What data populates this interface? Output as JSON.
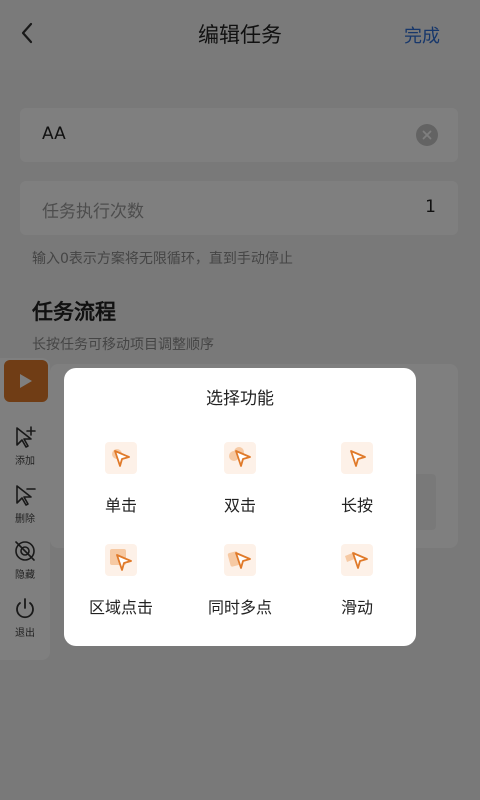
{
  "header": {
    "back_icon": "chevron-left-icon",
    "title": "编辑任务",
    "done_label": "完成",
    "done_color": "#2f6fd6"
  },
  "form": {
    "task_name_value": "AA",
    "clear_icon": "clear-circle-icon",
    "count_label": "任务执行次数",
    "count_value": "1",
    "hint": "输入0表示方案将无限循环，直到手动停止"
  },
  "flow": {
    "title": "任务流程",
    "subtitle": "长按任务可移动项目调整顺序"
  },
  "floating_toolbar": {
    "play_icon": "play-icon",
    "accent_color": "#e07a2a",
    "items": [
      {
        "label": "添加",
        "icon": "add-pointer-icon"
      },
      {
        "label": "删除",
        "icon": "remove-pointer-icon"
      },
      {
        "label": "隐藏",
        "icon": "hide-icon"
      },
      {
        "label": "退出",
        "icon": "power-icon"
      }
    ]
  },
  "dialog": {
    "title": "选择功能",
    "functions": [
      {
        "label": "单击",
        "icon": "single-tap-icon"
      },
      {
        "label": "双击",
        "icon": "double-tap-icon"
      },
      {
        "label": "长按",
        "icon": "long-press-icon"
      },
      {
        "label": "区域点击",
        "icon": "area-tap-icon"
      },
      {
        "label": "同时多点",
        "icon": "multi-tap-icon"
      },
      {
        "label": "滑动",
        "icon": "swipe-icon"
      }
    ]
  }
}
